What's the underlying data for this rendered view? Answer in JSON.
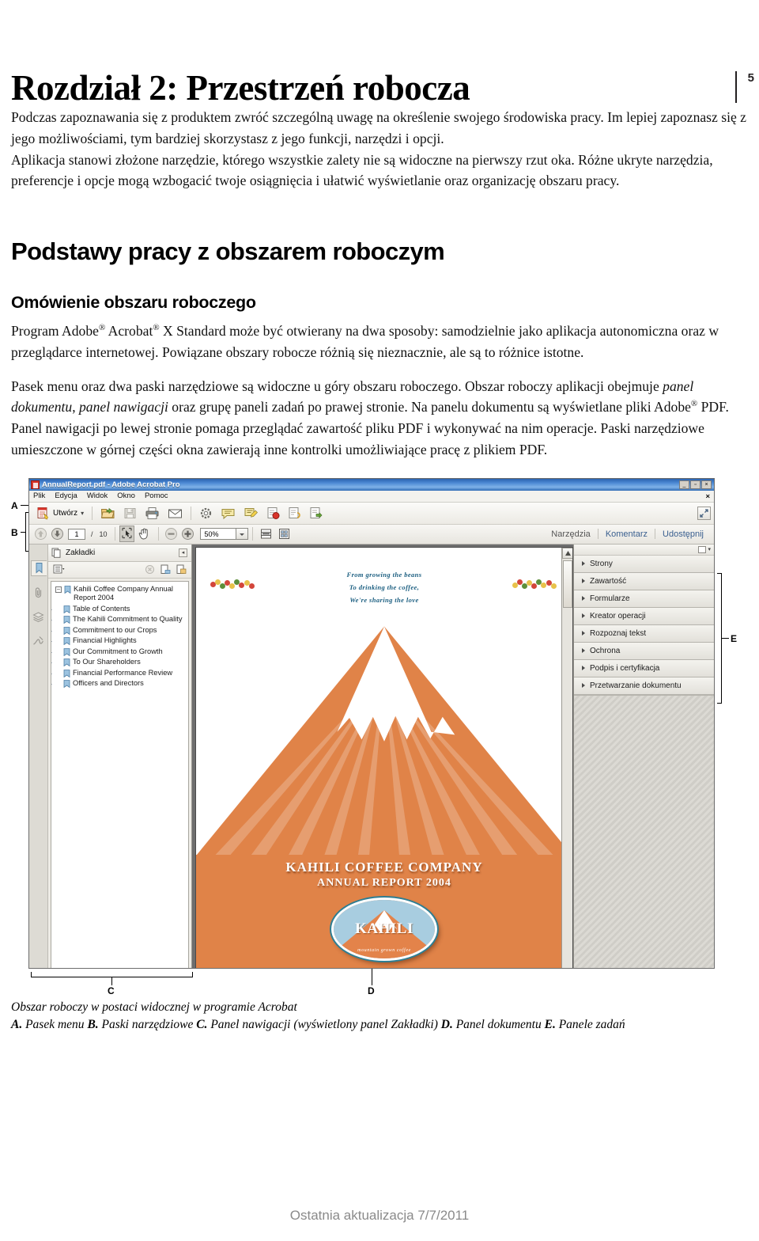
{
  "page": {
    "number": "5"
  },
  "chapter": {
    "title": "Rozdział 2: Przestrzeń robocza"
  },
  "intro": {
    "p1": "Podczas zapoznawania się z produktem zwróć szczególną uwagę na określenie swojego środowiska pracy. Im lepiej zapoznasz się z jego możliwościami, tym bardziej skorzystasz z jego funkcji, narzędzi i opcji.",
    "p2": "Aplikacja stanowi złożone narzędzie, którego wszystkie zalety nie są widoczne na pierwszy rzut oka.  Różne ukryte narzędzia, preferencje i opcje mogą wzbogacić twoje osiągnięcia i ułatwić wyświetlanie oraz organizację obszaru pracy."
  },
  "section": {
    "heading": "Podstawy pracy z obszarem roboczym",
    "subheading": "Omówienie obszaru roboczego",
    "p1_a": "Program Adobe",
    "p1_b": " Acrobat",
    "p1_c": " X Standard może być otwierany na dwa sposoby: samodzielnie jako aplikacja autonomiczna oraz w przeglądarce internetowej. Powiązane obszary robocze różnią się nieznacznie, ale są to różnice istotne.",
    "p2_a": "Pasek menu oraz dwa paski narzędziowe są widoczne u góry obszaru roboczego. Obszar roboczy aplikacji obejmuje ",
    "p2_i1": "panel dokumentu",
    "p2_b": ", ",
    "p2_i2": "panel nawigacji",
    "p2_c": " oraz grupę paneli zadań po prawej stronie. Na panelu dokumentu są wyświetlane pliki Adobe",
    "p2_d": " PDF. Panel nawigacji po lewej stronie pomaga przeglądać zawartość pliku PDF i wykonywać na nim operacje. Paski narzędziowe umieszczone w górnej części okna zawierają inne kontrolki umożliwiające pracę z plikiem PDF."
  },
  "callouts": {
    "a": "A",
    "b": "B",
    "c": "C",
    "d": "D",
    "e": "E"
  },
  "figure": {
    "caption_line1": "Obszar roboczy w postaci widocznej w programie Acrobat",
    "legend": [
      {
        "letter": "A.",
        "text": " Pasek menu "
      },
      {
        "letter": "B.",
        "text": " Paski narzędziowe "
      },
      {
        "letter": "C.",
        "text": " Panel nawigacji (wyświetlony panel Zakładki) "
      },
      {
        "letter": "D.",
        "text": " Panel dokumentu "
      },
      {
        "letter": "E.",
        "text": " Panele zadań"
      }
    ]
  },
  "acrobat": {
    "window_title": "AnnualReport.pdf - Adobe Acrobat Pro",
    "window_buttons": {
      "minimize": "_",
      "restore": "▫",
      "close": "×"
    },
    "menu": [
      "Plik",
      "Edycja",
      "Widok",
      "Okno",
      "Pomoc"
    ],
    "menu_close": "×",
    "toolbar1": {
      "create_label": "Utwórz",
      "create_caret": "▾",
      "icons": [
        "create-pdf-icon",
        "open-folder-icon",
        "save-icon",
        "print-icon",
        "email-icon",
        "settings-icon",
        "sticky-note-icon",
        "highlight-text-icon",
        "stamp-icon",
        "attach-file-icon",
        "export-icon"
      ]
    },
    "toolbar2": {
      "page_value": "1",
      "page_separator": "/",
      "page_total": "10",
      "zoom_value": "50%",
      "icons": [
        "previous-page-icon",
        "next-page-icon",
        "select-tool-icon",
        "hand-tool-icon",
        "zoom-out-icon",
        "zoom-in-icon",
        "fit-width-icon",
        "fit-page-icon"
      ]
    },
    "tabs": [
      {
        "label": "Narzędzia",
        "style": "grey"
      },
      {
        "label": "Komentarz",
        "style": "blue"
      },
      {
        "label": "Udostępnij",
        "style": "blue"
      }
    ],
    "nav": {
      "panel_title": "Zakładki",
      "collapse_glyph": "◂",
      "strip_icons": [
        "page-thumbnails-icon",
        "bookmarks-icon",
        "attachments-icon",
        "layers-icon",
        "signatures-icon"
      ],
      "tool_icons": [
        "bookmark-options-icon",
        "delete-bookmark-icon",
        "new-bookmark-icon",
        "new-bookmark-from-selection-icon"
      ],
      "bookmarks": [
        {
          "label": "Kahili Coffee Company Annual Report 2004",
          "level": 0
        },
        {
          "label": "Table of Contents",
          "level": 1
        },
        {
          "label": "The Kahili Commitment to Quality",
          "level": 1
        },
        {
          "label": "Commitment to our Crops",
          "level": 1
        },
        {
          "label": "Financial Highlights",
          "level": 1
        },
        {
          "label": "Our Commitment to Growth",
          "level": 1
        },
        {
          "label": "To Our Shareholders",
          "level": 1
        },
        {
          "label": "Financial Performance Review",
          "level": 1
        },
        {
          "label": "Officers and Directors",
          "level": 1
        }
      ]
    },
    "task_panes": [
      "Strony",
      "Zawartość",
      "Formularze",
      "Kreator operacji",
      "Rozpoznaj tekst",
      "Ochrona",
      "Podpis i certyfikacja",
      "Przetwarzanie dokumentu"
    ],
    "document": {
      "poem_line1": "From growing the beans",
      "poem_line2": "To drinking the coffee,",
      "poem_line3": "We're sharing the love",
      "title_line1": "KAHILI COFFEE COMPANY",
      "title_line2": "ANNUAL REPORT 2004",
      "logo_word": "KAHILI",
      "logo_sub": "mountain grown coffee",
      "accent_orange": "#e08348",
      "logo_sky": "#a8cde0",
      "poem_color": "#1b5e80"
    }
  },
  "footer": {
    "text": "Ostatnia aktualizacja 7/7/2011"
  }
}
